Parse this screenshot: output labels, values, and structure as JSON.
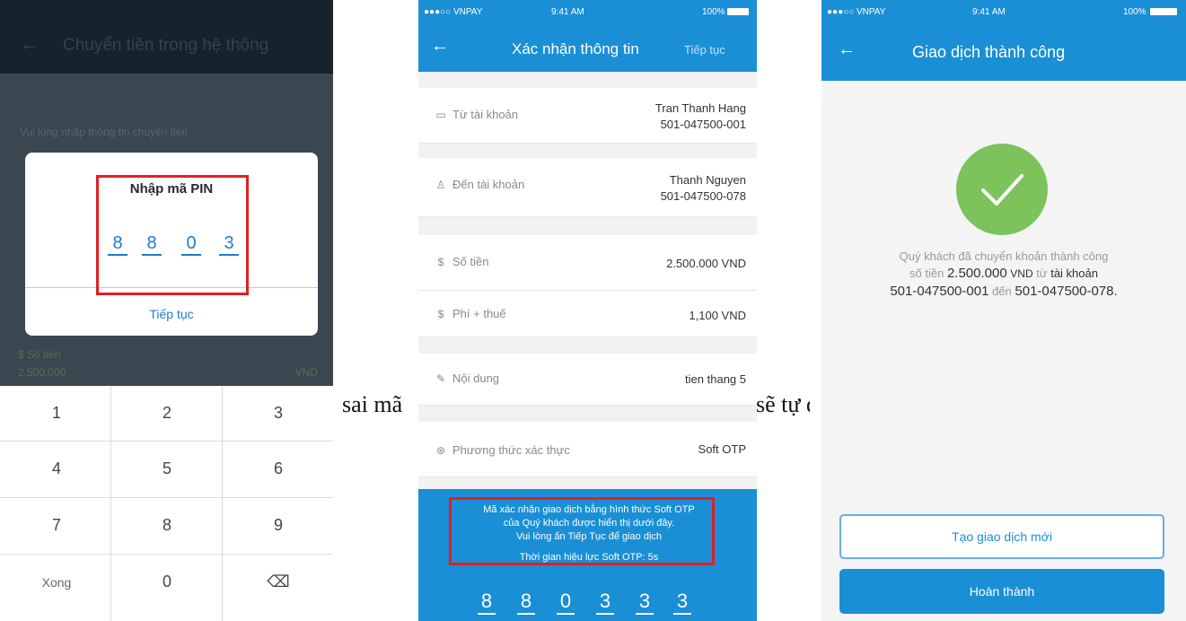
{
  "doc": {
    "left_text": "sai mã",
    "right_text": "sẽ tự đ"
  },
  "screen1": {
    "title": "Chuyển tiền trong hệ thống",
    "hint": "Vui lòng nhập thông tin chuyển tiền",
    "amount_label": "Số tiền",
    "amount_value": "2.500.000",
    "amount_unit": "VND",
    "dialog": {
      "title": "Nhập mã PIN",
      "pin": [
        "8",
        "8",
        "0",
        "3"
      ],
      "continue": "Tiếp tục"
    },
    "keypad": [
      "1",
      "2",
      "3",
      "4",
      "5",
      "6",
      "7",
      "8",
      "9",
      "Xong",
      "0",
      "⌫"
    ]
  },
  "screen2": {
    "status": {
      "carrier": "●●●○○ VNPAY",
      "time": "9:41 AM",
      "battery": "100%"
    },
    "title": "Xác nhận thông tin",
    "next": "Tiếp tục",
    "rows": [
      {
        "label": "Từ tài khoản",
        "value1": "Tran Thanh Hang",
        "value2": "501-047500-001"
      },
      {
        "label": "Đến tài khoản",
        "value1": "Thanh Nguyen",
        "value2": "501-047500-078"
      },
      {
        "label": "Số tiền",
        "value1": "2.500.000 VND"
      },
      {
        "label": "Phí + thuế",
        "value1": "1,100 VND"
      },
      {
        "label": "Nội dung",
        "value1": "tien thang 5"
      },
      {
        "label": "Phương thức xác thực",
        "value1": "Soft OTP"
      }
    ],
    "otp_message": [
      "Mã xác nhận giao dịch bằng hình thức Soft OTP",
      "của Quý khách được hiển thị dưới đây.",
      "Vui lòng ấn Tiếp Tục để giao dịch"
    ],
    "otp_time": "Thời gian hiệu lực Soft OTP: 5s",
    "otp": [
      "8",
      "8",
      "0",
      "3",
      "3",
      "3"
    ]
  },
  "screen3": {
    "status": {
      "carrier": "●●●○○ VNPAY",
      "time": "9:41 AM",
      "battery": "100%"
    },
    "title": "Giao dịch thành công",
    "message": {
      "p1": "Quý khách đã chuyển khoản thành công",
      "p2": "số tiền",
      "amount": "2.500.000",
      "unit": "VND",
      "p3": "từ",
      "p4": "tài khoản",
      "from": "501-047500-001",
      "p5": "đến",
      "to": "501-047500-078",
      "end": "."
    },
    "btn_new": "Tạo giao dịch mới",
    "btn_done": "Hoàn thành"
  },
  "colors": {
    "primary": "#1a8fd6",
    "success": "#7cc35b",
    "highlight": "#e02020"
  }
}
